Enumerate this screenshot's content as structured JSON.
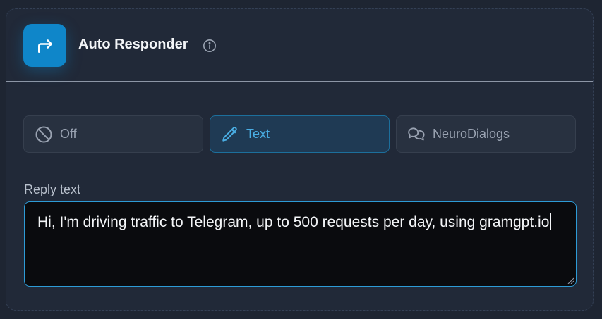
{
  "header": {
    "title": "Auto Responder",
    "badge_icon": "forward-arrow-icon",
    "info_icon": "info-icon"
  },
  "modes": [
    {
      "label": "Off",
      "icon": "ban-icon",
      "selected": false
    },
    {
      "label": "Text",
      "icon": "pencil-icon",
      "selected": true
    },
    {
      "label": "NeuroDialogs",
      "icon": "chat-bubbles-icon",
      "selected": false
    }
  ],
  "reply": {
    "label": "Reply text",
    "value": "Hi, I'm driving traffic to Telegram, up to 500 requests per day, using gramgpt.io"
  },
  "colors": {
    "accent": "#0f86c9",
    "selected_text": "#4aaee4",
    "background": "#1e2532"
  }
}
